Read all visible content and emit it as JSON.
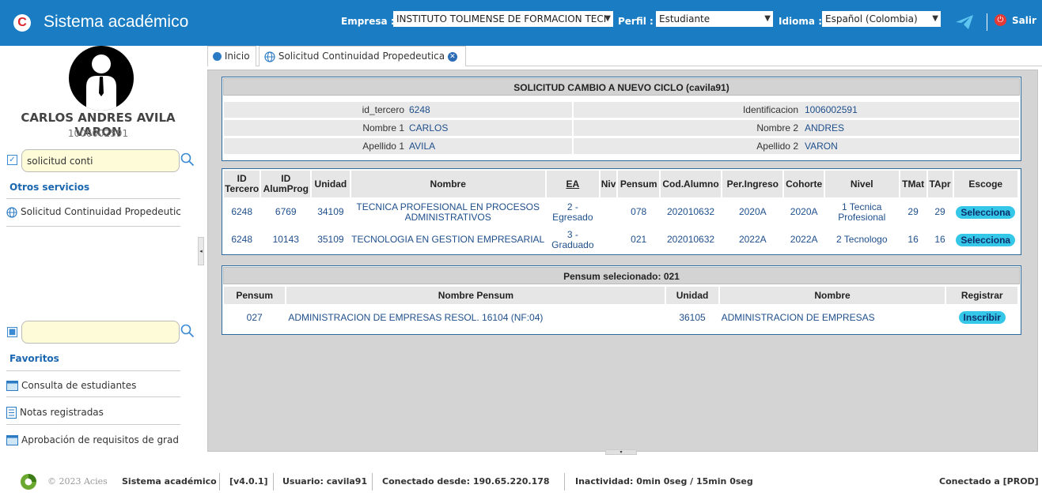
{
  "header": {
    "app_title": "Sistema académico",
    "logo_letter": "C",
    "empresa_label": "Empresa :",
    "empresa_value": "INSTITUTO TOLIMENSE DE FORMACION TECI",
    "perfil_label": "Perfil :",
    "perfil_value": "Estudiante",
    "idioma_label": "Idioma :",
    "idioma_value": "Español (Colombia)",
    "salir_label": "Salir",
    "accent_color": "#1a7dc3"
  },
  "user": {
    "name": "CARLOS ANDRES AVILA VARON",
    "id": "1006002591"
  },
  "sidebar": {
    "search_value": "solicitud conti",
    "otros_heading": "Otros servicios",
    "otros_items": [
      {
        "label": "Solicitud Continuidad Propedeutic",
        "icon": "globe-icon"
      }
    ],
    "fav_search_value": "",
    "favoritos_heading": "Favoritos",
    "fav_items": [
      {
        "label": "Consulta de estudiantes",
        "icon": "table-icon"
      },
      {
        "label": "Notas registradas",
        "icon": "list-icon"
      },
      {
        "label": "Aprobación de requisitos de grad",
        "icon": "table-icon"
      }
    ]
  },
  "tabs": [
    {
      "label": "Inicio",
      "icon": "dot-icon"
    },
    {
      "label": "Solicitud Continuidad Propedeutica",
      "icon": "globe-icon"
    }
  ],
  "request": {
    "title": "SOLICITUD CAMBIO A NUEVO CICLO (cavila91)",
    "fields_left": [
      {
        "label": "id_tercero",
        "value": "6248"
      },
      {
        "label": "Nombre 1",
        "value": "CARLOS"
      },
      {
        "label": "Apellido 1",
        "value": "AVILA"
      }
    ],
    "fields_right": [
      {
        "label": "Identificacion",
        "value": "1006002591"
      },
      {
        "label": "Nombre 2",
        "value": "ANDRES"
      },
      {
        "label": "Apellido 2",
        "value": "VARON"
      }
    ]
  },
  "programs": {
    "headers": [
      "ID Tercero",
      "ID AlumProg",
      "Unidad",
      "Nombre",
      "EA",
      "Niv",
      "Pensum",
      "Cod.Alumno",
      "Per.Ingreso",
      "Cohorte",
      "Nivel",
      "TMat",
      "TApr",
      "Escoge"
    ],
    "rows": [
      [
        "6248",
        "6769",
        "34109",
        "TECNICA PROFESIONAL EN PROCESOS ADMINISTRATIVOS",
        "2 - Egresado",
        "",
        "078",
        "202010632",
        "2020A",
        "2020A",
        "1 Tecnica Profesional",
        "29",
        "29",
        "Selecciona"
      ],
      [
        "6248",
        "10143",
        "35109",
        "TECNOLOGIA EN GESTION EMPRESARIAL",
        "3 - Graduado",
        "",
        "021",
        "202010632",
        "2022A",
        "2022A",
        "2 Tecnologo",
        "16",
        "16",
        "Selecciona"
      ]
    ]
  },
  "pensum": {
    "title": "Pensum selecionado: 021",
    "headers": [
      "Pensum",
      "Nombre Pensum",
      "Unidad",
      "Nombre",
      "Registrar"
    ],
    "rows": [
      [
        "027",
        "ADMINISTRACION DE EMPRESAS RESOL. 16104 (NF:04)",
        "36105",
        "ADMINISTRACION DE EMPRESAS",
        "Inscribir"
      ]
    ]
  },
  "footer": {
    "copyright": "© 2023 Acies",
    "system": "Sistema académico",
    "version": "[v4.0.1]",
    "usuario": "Usuario: cavila91",
    "conectado_desde": "Conectado desde: 190.65.220.178",
    "inactividad": "Inactividad: 0min 0seg / 15min 0seg",
    "conectado_a": "Conectado a [PROD]"
  }
}
